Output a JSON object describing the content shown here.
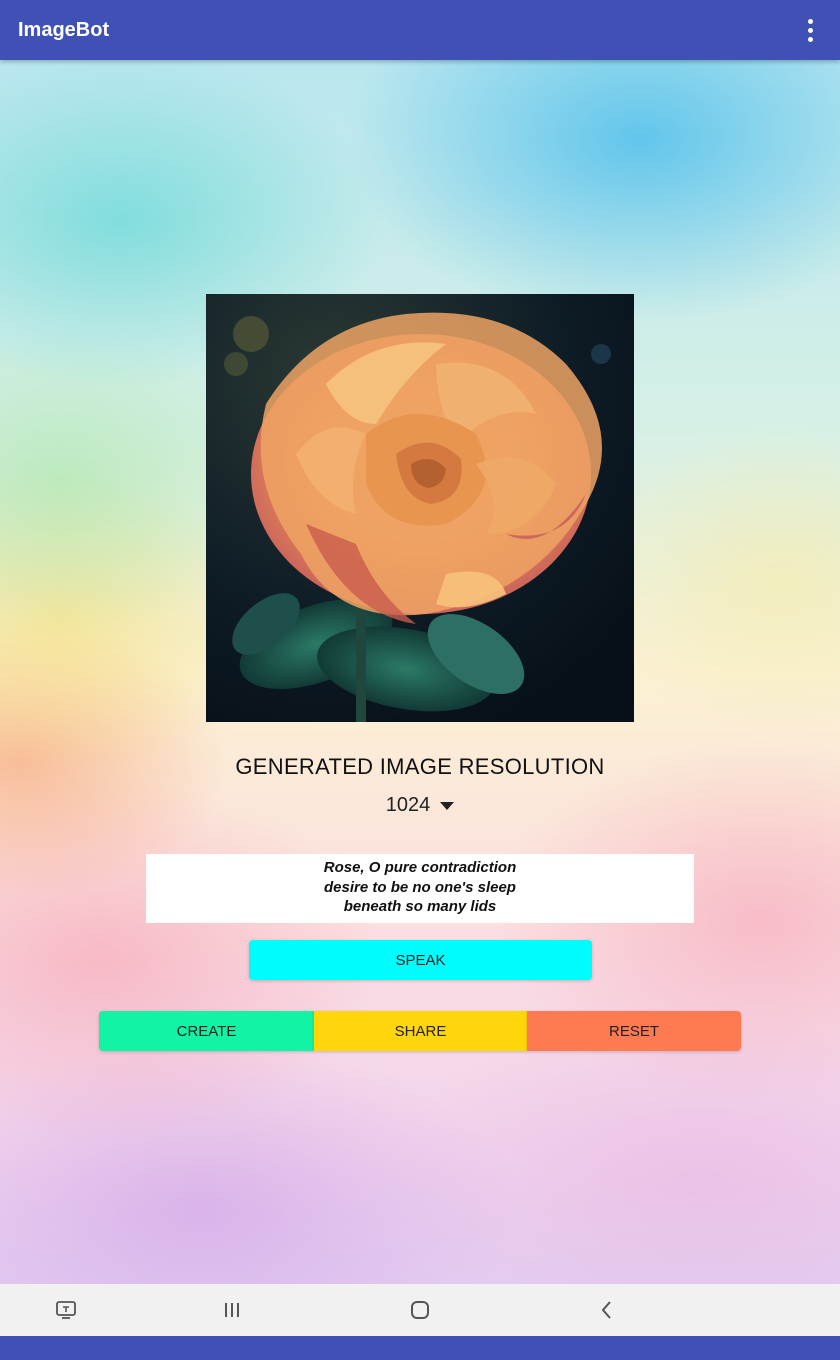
{
  "app": {
    "title": "ImageBot",
    "bar_color": "#3f51b5",
    "overflow_icon": "more-vert-icon"
  },
  "image": {
    "subject_icon": "rose-photo"
  },
  "resolution": {
    "label": "GENERATED IMAGE RESOLUTION",
    "selected": "1024"
  },
  "poem": {
    "lines": [
      "Rose, O pure contradiction",
      "desire to be no one's sleep",
      "beneath so many lids"
    ]
  },
  "buttons": {
    "speak": {
      "label": "SPEAK",
      "color": "#00fdfd"
    },
    "create": {
      "label": "CREATE",
      "color": "#12f3a6"
    },
    "share": {
      "label": "SHARE",
      "color": "#ffd60b"
    },
    "reset": {
      "label": "RESET",
      "color": "#fe7a52"
    }
  },
  "navbar": {
    "items": [
      "keyboard-icon",
      "recents-icon",
      "home-icon",
      "back-icon"
    ]
  }
}
